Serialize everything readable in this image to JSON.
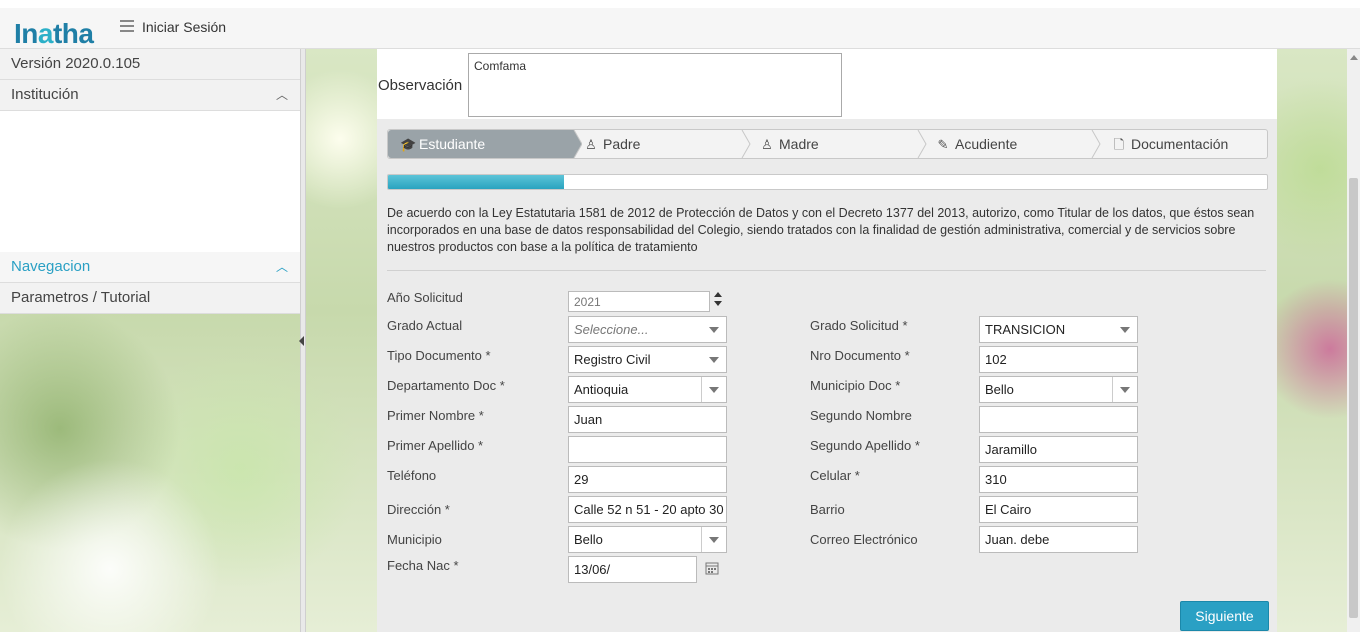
{
  "header": {
    "logo_text": "Inatha",
    "login_label": "Iniciar Sesión"
  },
  "sidebar": {
    "version": "Versión 2020.0.105",
    "institution": "Institución",
    "navigation": "Navegacion",
    "tutorial": "Parametros / Tutorial"
  },
  "observation": {
    "label": "Observación",
    "value": "Comfama"
  },
  "wizard": {
    "steps": [
      {
        "label": "Estudiante",
        "icon": "graduate-icon",
        "active": true
      },
      {
        "label": "Padre",
        "icon": "user-icon",
        "active": false
      },
      {
        "label": "Madre",
        "icon": "user-icon",
        "active": false
      },
      {
        "label": "Acudiente",
        "icon": "pencil-icon",
        "active": false
      },
      {
        "label": "Documentación",
        "icon": "document-icon",
        "active": false
      }
    ],
    "progress_fraction": 0.2
  },
  "legal_text": "De acuerdo con la Ley Estatutaria 1581 de 2012 de Protección de Datos y con el Decreto 1377 del 2013, autorizo, como Titular de los datos, que éstos sean incorporados en una base de datos responsabilidad del Colegio, siendo tratados con la finalidad de gestión administrativa, comercial y de servicios sobre nuestros productos con base a la política de tratamiento",
  "form": {
    "anio_solicitud": {
      "label": "Año Solicitud",
      "value": "2021"
    },
    "grado_actual": {
      "label": "Grado Actual",
      "placeholder": "Seleccione..."
    },
    "grado_solicitud": {
      "label": "Grado Solicitud *",
      "value": "TRANSICION"
    },
    "tipo_documento": {
      "label": "Tipo Documento *",
      "value": "Registro Civil"
    },
    "nro_documento": {
      "label": "Nro Documento *",
      "value": "102"
    },
    "departamento_doc": {
      "label": "Departamento Doc *",
      "value": "Antioquia"
    },
    "municipio_doc": {
      "label": "Municipio Doc *",
      "value": "Bello"
    },
    "primer_nombre": {
      "label": "Primer Nombre *",
      "value": "Juan"
    },
    "segundo_nombre": {
      "label": "Segundo Nombre",
      "value": ""
    },
    "primer_apellido": {
      "label": "Primer Apellido *",
      "value": ""
    },
    "segundo_apellido": {
      "label": "Segundo Apellido *",
      "value": "Jaramillo"
    },
    "telefono": {
      "label": "Teléfono",
      "value": "29"
    },
    "celular": {
      "label": "Celular *",
      "value": "310"
    },
    "direccion": {
      "label": "Dirección *",
      "value": "Calle 52 n 51 - 20 apto 30"
    },
    "barrio": {
      "label": "Barrio",
      "value": "El Cairo"
    },
    "municipio": {
      "label": "Municipio",
      "value": "Bello"
    },
    "correo": {
      "label": "Correo Electrónico",
      "value": "Juan.          debe"
    },
    "fecha_nac": {
      "label": "Fecha Nac *",
      "value": "13/06/"
    }
  },
  "buttons": {
    "next": "Siguiente"
  },
  "colors": {
    "accent": "#2aa0c4",
    "active_step": "#9aa3a8"
  }
}
